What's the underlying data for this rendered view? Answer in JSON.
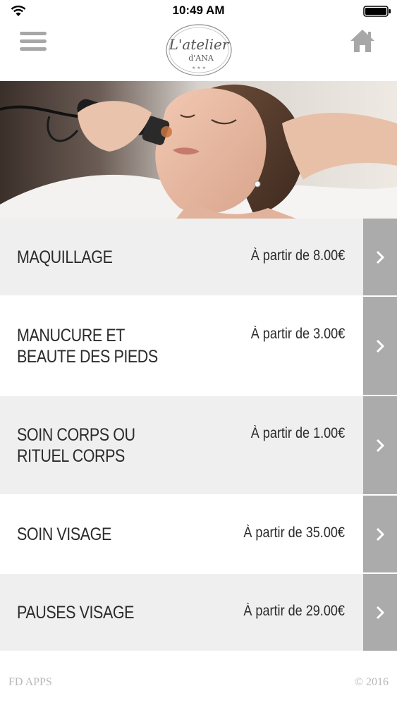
{
  "status_bar": {
    "time": "10:49 AM"
  },
  "header": {
    "logo_text": "L'atelier d'ANA",
    "logo_line1": "L'atelier",
    "logo_line2": "d'ANA"
  },
  "services": [
    {
      "title": "MAQUILLAGE",
      "price": "À partir de 8.00€"
    },
    {
      "title": "MANUCURE ET BEAUTE DES PIEDS",
      "price": "À partir de 3.00€"
    },
    {
      "title": "SOIN CORPS OU RITUEL CORPS",
      "price": "À partir de 1.00€"
    },
    {
      "title": "SOIN VISAGE",
      "price": "À partir de 35.00€"
    },
    {
      "title": "PAUSES VISAGE",
      "price": "À partir de 29.00€"
    }
  ],
  "footer": {
    "left": "FD APPS",
    "right": "© 2016"
  },
  "colors": {
    "arrow_bg": "#ababab",
    "row_alt": "#efefef",
    "icon_gray": "#a7a7a7"
  }
}
